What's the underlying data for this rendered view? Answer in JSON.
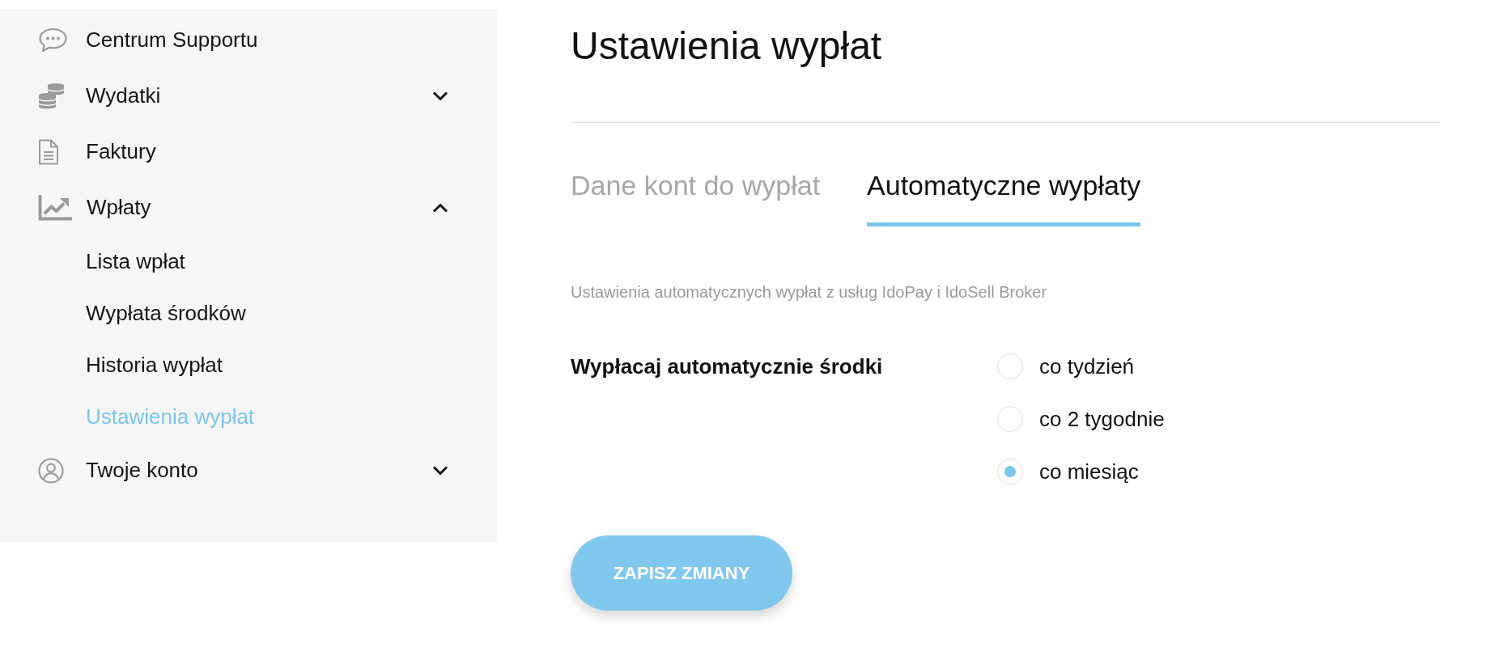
{
  "sidebar": {
    "items": [
      {
        "kind": "link",
        "label": "Centrum Supportu",
        "selected": false
      },
      {
        "kind": "group",
        "label": "Wydatki",
        "selected": false,
        "expanded": false
      },
      {
        "kind": "link",
        "label": "Faktury",
        "selected": false
      },
      {
        "kind": "group",
        "label": "Wpłaty",
        "selected": false,
        "expanded": true,
        "children": [
          {
            "label": "Lista wpłat",
            "selected": false
          },
          {
            "label": "Wypłata środków",
            "selected": false
          },
          {
            "label": "Historia wypłat",
            "selected": false
          },
          {
            "label": "Ustawienia wypłat",
            "selected": true
          }
        ]
      },
      {
        "kind": "group",
        "label": "Twoje konto",
        "selected": false,
        "expanded": false
      }
    ]
  },
  "page_title": "Ustawienia wypłat",
  "tabs": [
    {
      "label": "Dane kont do wypłat",
      "selected": false
    },
    {
      "label": "Automatyczne wypłaty",
      "selected": true
    }
  ],
  "description": "Ustawienia automatycznych wypłat z usług IdoPay i IdoSell Broker",
  "payout_setting": {
    "label": "Wypłacaj automatycznie środki",
    "options": [
      {
        "label": "co tydzień",
        "selected": false
      },
      {
        "label": "co 2 tygodnie",
        "selected": false
      },
      {
        "label": "co miesiąc",
        "selected": true
      }
    ]
  },
  "save_button": {
    "label": "ZAPISZ ZMIANY"
  }
}
